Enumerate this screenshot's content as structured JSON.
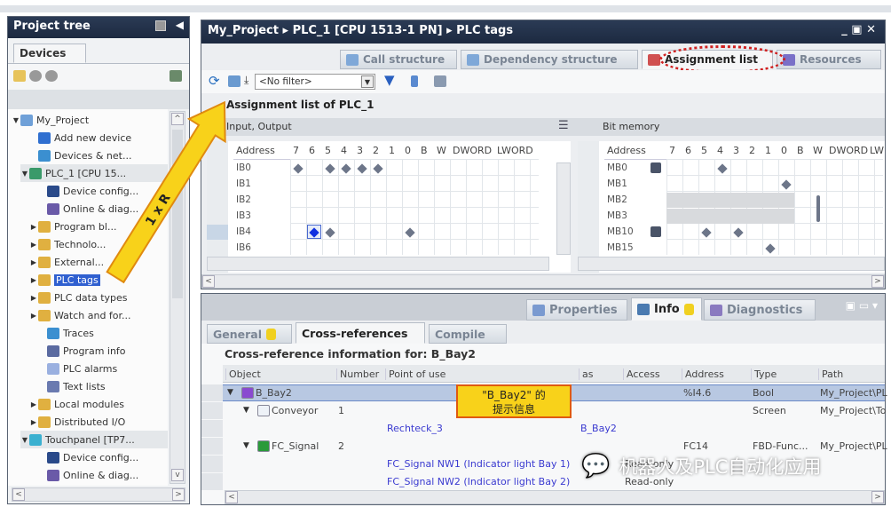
{
  "project_tree": {
    "title": "Project tree",
    "tab": "Devices",
    "items": [
      {
        "label": "My_Project",
        "level": 0,
        "expand": "open",
        "icon": "project-icon",
        "color": "#6fa0d8"
      },
      {
        "label": "Add new device",
        "level": 2,
        "expand": "",
        "icon": "add-device-icon",
        "color": "#2f6fd0"
      },
      {
        "label": "Devices & net...",
        "level": 2,
        "expand": "",
        "icon": "network-icon",
        "color": "#3b8fd0"
      },
      {
        "label": "PLC_1 [CPU 15...",
        "level": 1,
        "expand": "open",
        "icon": "plc-icon",
        "color": "#3a9a6a"
      },
      {
        "label": "Device config...",
        "level": 3,
        "expand": "",
        "icon": "device-config-icon",
        "color": "#2a4a8a"
      },
      {
        "label": "Online & diag...",
        "level": 3,
        "expand": "",
        "icon": "online-diag-icon",
        "color": "#6a5aa8"
      },
      {
        "label": "Program bl...",
        "level": 2,
        "expand": "closed",
        "icon": "folder-icon",
        "color": "#e0b040"
      },
      {
        "label": "Technolo...",
        "level": 2,
        "expand": "closed",
        "icon": "folder-icon",
        "color": "#e0b040"
      },
      {
        "label": "External...",
        "level": 2,
        "expand": "closed",
        "icon": "folder-icon",
        "color": "#e0b040"
      },
      {
        "label": "PLC tags",
        "level": 2,
        "expand": "closed",
        "icon": "folder-icon",
        "color": "#e0b040",
        "selected": true
      },
      {
        "label": "PLC data types",
        "level": 2,
        "expand": "closed",
        "icon": "folder-icon",
        "color": "#e0b040"
      },
      {
        "label": "Watch and for...",
        "level": 2,
        "expand": "closed",
        "icon": "folder-icon",
        "color": "#e0b040"
      },
      {
        "label": "Traces",
        "level": 3,
        "expand": "",
        "icon": "traces-icon",
        "color": "#3b8fd0"
      },
      {
        "label": "Program info",
        "level": 3,
        "expand": "",
        "icon": "program-info-icon",
        "color": "#5a6aa0"
      },
      {
        "label": "PLC alarms",
        "level": 3,
        "expand": "",
        "icon": "alarms-icon",
        "color": "#9ab0e0"
      },
      {
        "label": "Text lists",
        "level": 3,
        "expand": "",
        "icon": "text-lists-icon",
        "color": "#6a7ab0"
      },
      {
        "label": "Local modules",
        "level": 2,
        "expand": "closed",
        "icon": "folder-icon",
        "color": "#e0b040"
      },
      {
        "label": "Distributed I/O",
        "level": 2,
        "expand": "closed",
        "icon": "folder-icon",
        "color": "#e0b040"
      },
      {
        "label": "Touchpanel [TP7...",
        "level": 1,
        "expand": "open",
        "icon": "hmi-icon",
        "color": "#3ab0d0"
      },
      {
        "label": "Device config...",
        "level": 3,
        "expand": "",
        "icon": "device-config-icon",
        "color": "#2a4a8a"
      },
      {
        "label": "Online & diag...",
        "level": 3,
        "expand": "",
        "icon": "online-diag-icon",
        "color": "#6a5aa8"
      }
    ]
  },
  "editor": {
    "breadcrumb": [
      "My_Project",
      "PLC_1 [CPU 1513-1 PN]",
      "PLC tags"
    ],
    "tabs": [
      {
        "label": "Call structure"
      },
      {
        "label": "Dependency structure"
      },
      {
        "label": "Assignment list",
        "active": true
      },
      {
        "label": "Resources"
      }
    ],
    "filter": "<No filter>",
    "heading": "Assignment list of PLC_1",
    "io": {
      "title": "Input, Output",
      "columns": [
        "Address",
        "7",
        "6",
        "5",
        "4",
        "3",
        "2",
        "1",
        "0",
        "B",
        "W",
        "DWORD",
        "LWORD"
      ],
      "rows": [
        {
          "address": "IB0",
          "bits": [
            "7",
            "5",
            "4",
            "3",
            "2"
          ]
        },
        {
          "address": "IB1",
          "bits": []
        },
        {
          "address": "IB2",
          "bits": []
        },
        {
          "address": "IB3",
          "bits": []
        },
        {
          "address": "IB4",
          "bits": [
            "6",
            "5",
            "0"
          ],
          "selected_bit": "6"
        },
        {
          "address": "IB6",
          "bits": []
        }
      ]
    },
    "memory": {
      "title": "Bit memory",
      "columns": [
        "Address",
        "7",
        "6",
        "5",
        "4",
        "3",
        "2",
        "1",
        "0",
        "B",
        "W",
        "DWORD",
        "LW"
      ],
      "rows": [
        {
          "address": "MB0",
          "bits": [
            "4"
          ]
        },
        {
          "address": "MB1",
          "bits": [
            "0"
          ]
        },
        {
          "address": "MB2",
          "bits": [],
          "word": true
        },
        {
          "address": "MB3",
          "bits": [],
          "word": true
        },
        {
          "address": "MB10",
          "bits": [
            "5",
            "3"
          ]
        },
        {
          "address": "MB15",
          "bits": [
            "1"
          ]
        }
      ]
    }
  },
  "inspector": {
    "top_tabs": [
      "Properties",
      "Info",
      "Diagnostics"
    ],
    "active_top": "Info",
    "sub_tabs": [
      "General",
      "Cross-references",
      "Compile"
    ],
    "active_sub": "Cross-references",
    "heading": "Cross-reference information for: B_Bay2",
    "columns": [
      "Object",
      "Number",
      "Point of use",
      "as",
      "Access",
      "Address",
      "Type",
      "Path"
    ],
    "rows": [
      {
        "object": "B_Bay2",
        "level": 0,
        "number": "",
        "point": "",
        "as": "",
        "access": "",
        "address": "%I4.6",
        "type": "Bool",
        "path": "My_Project\\PL"
      },
      {
        "object": "Conveyor",
        "level": 1,
        "number": "1",
        "point": "",
        "as": "",
        "access": "",
        "address": "",
        "type": "Screen",
        "path": "My_Project\\To"
      },
      {
        "object": "",
        "level": 2,
        "number": "",
        "point": "Rechteck_3",
        "as": "B_Bay2",
        "access": "",
        "address": "",
        "type": "",
        "path": ""
      },
      {
        "object": "FC_Signal",
        "level": 1,
        "number": "2",
        "point": "",
        "as": "",
        "access": "",
        "address": "FC14",
        "type": "FBD-Func...",
        "path": "My_Project\\PL"
      },
      {
        "object": "",
        "level": 2,
        "number": "",
        "point": "FC_Signal NW1 (Indicator light Bay 1)",
        "as": "",
        "access": "Read-only",
        "address": "",
        "type": "",
        "path": ""
      },
      {
        "object": "",
        "level": 2,
        "number": "",
        "point": "FC_Signal NW2 (Indicator light Bay 2)",
        "as": "",
        "access": "Read-only",
        "address": "",
        "type": "",
        "path": ""
      }
    ]
  },
  "annotations": {
    "arrow_label": "1 x R",
    "callout_line1": "\"B_Bay2\" 的",
    "callout_line2": "提示信息"
  },
  "watermark": "机器人及PLC自动化应用"
}
